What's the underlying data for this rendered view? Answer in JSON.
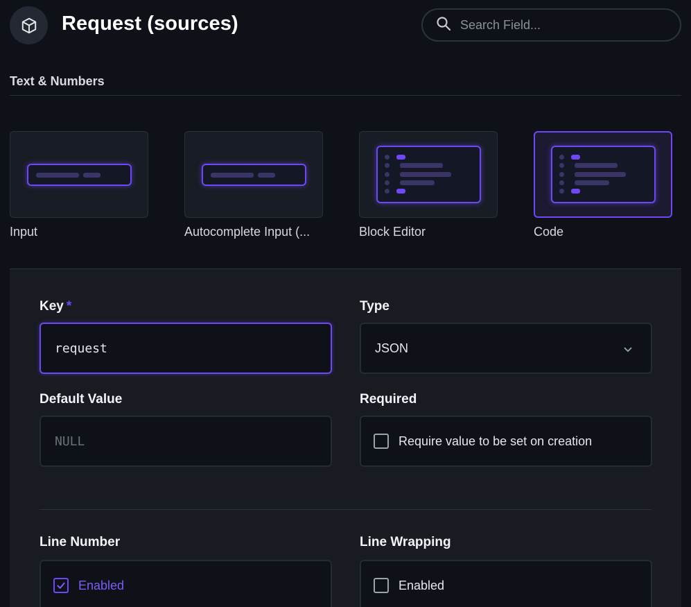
{
  "header": {
    "title": "Request (sources)",
    "icon": "cube-icon",
    "search_placeholder": "Search Field..."
  },
  "section": {
    "title": "Text & Numbers"
  },
  "interfaces": [
    {
      "label": "Input",
      "selected": false
    },
    {
      "label": "Autocomplete Input (...",
      "selected": false
    },
    {
      "label": "Block Editor",
      "selected": false
    },
    {
      "label": "Code",
      "selected": true
    }
  ],
  "form": {
    "key": {
      "label": "Key",
      "required_mark": "*",
      "value": "request"
    },
    "type": {
      "label": "Type",
      "value": "JSON"
    },
    "default_value": {
      "label": "Default Value",
      "placeholder": "NULL"
    },
    "required": {
      "label": "Required",
      "checkbox_label": "Require value to be set on creation",
      "checked": false
    },
    "line_number": {
      "label": "Line Number",
      "checkbox_label": "Enabled",
      "checked": true
    },
    "line_wrapping": {
      "label": "Line Wrapping",
      "checkbox_label": "Enabled",
      "checked": false
    }
  },
  "colors": {
    "accent": "#6e48f5",
    "background": "#0e1118",
    "panel": "#181b22"
  }
}
